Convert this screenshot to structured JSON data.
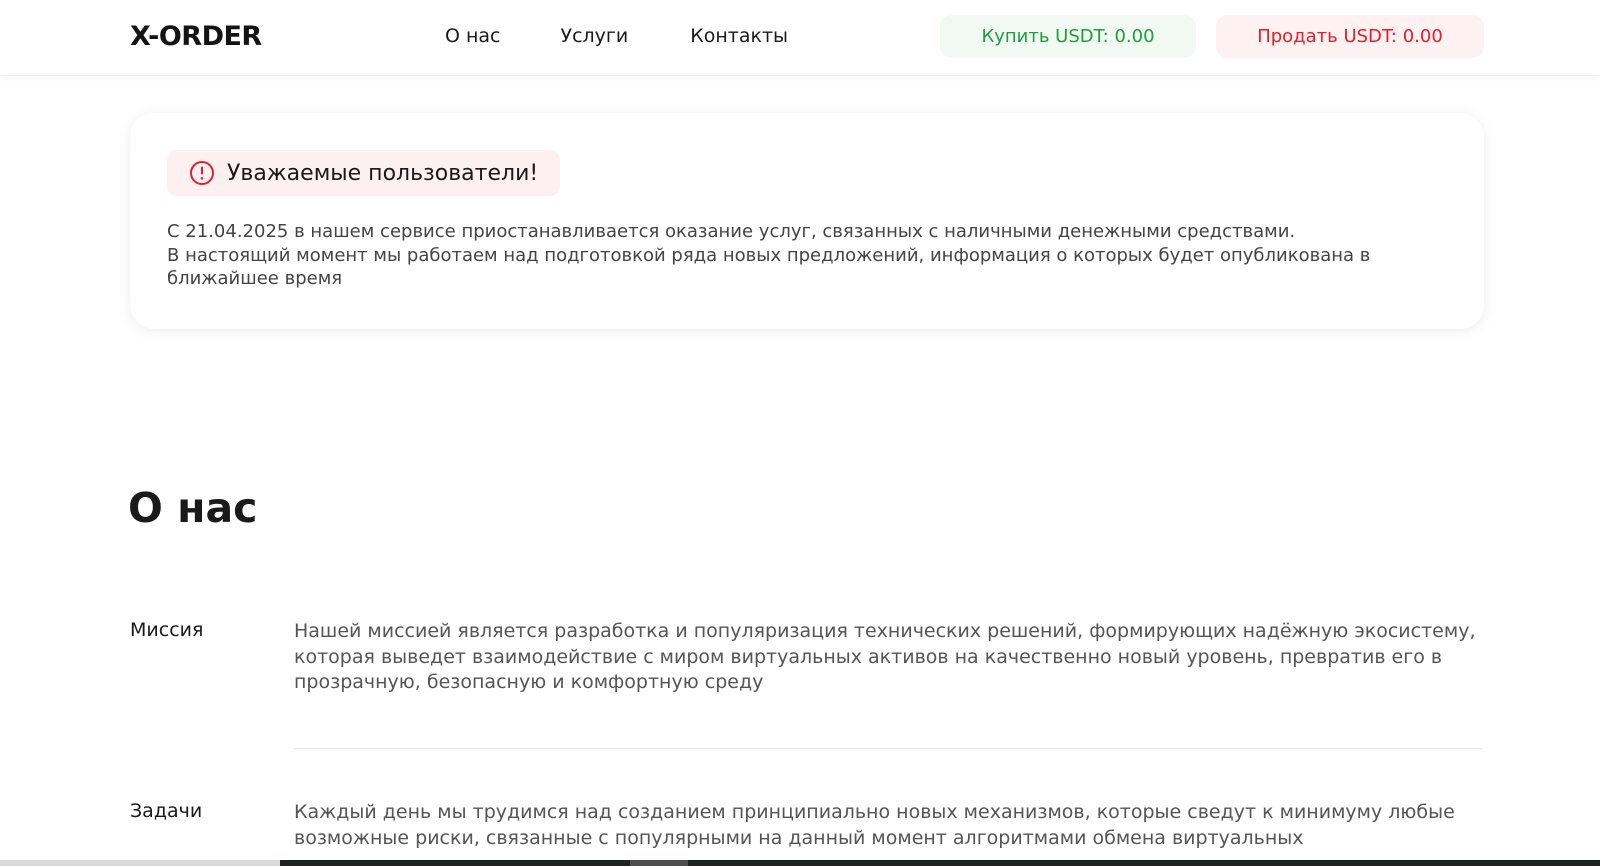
{
  "header": {
    "logo_text": "X-ORDER",
    "nav": [
      {
        "label": "О нас"
      },
      {
        "label": "Услуги"
      },
      {
        "label": "Контакты"
      }
    ],
    "buy_label": "Купить USDT: 0.00",
    "sell_label": "Продать USDT: 0.00"
  },
  "notice": {
    "icon": "alert-circle-icon",
    "title": "Уважаемые пользователи!",
    "lines": [
      "С 21.04.2025 в нашем сервисе приостанавливается оказание услуг, связанных с наличными денежными средствами.",
      "В настоящий момент мы работаем над подготовкой ряда новых предложений, информация о которых будет опубликована в ближайшее время"
    ]
  },
  "about": {
    "title": "О нас",
    "items": [
      {
        "label": "Миссия",
        "text": "Нашей миссией является разработка и популяризация технических решений, формирующих надёжную экосистему, которая выведет взаимодействие с миром виртуальных активов на качественно новый уровень, превратив его в прозрачную, безопасную и комфортную среду"
      },
      {
        "label": "Задачи",
        "text": "Каждый день мы трудимся над созданием принципиально новых механизмов, которые сведут к минимуму любые возможные риски, связанные с популярными на данный момент алгоритмами обмена виртуальных"
      }
    ]
  },
  "colors": {
    "buy_text": "#1e9e3c",
    "buy_bg": "#f1f9f2",
    "sell_text": "#e0202a",
    "sell_bg": "#fdf1f1",
    "alert_icon": "#e0202a"
  }
}
